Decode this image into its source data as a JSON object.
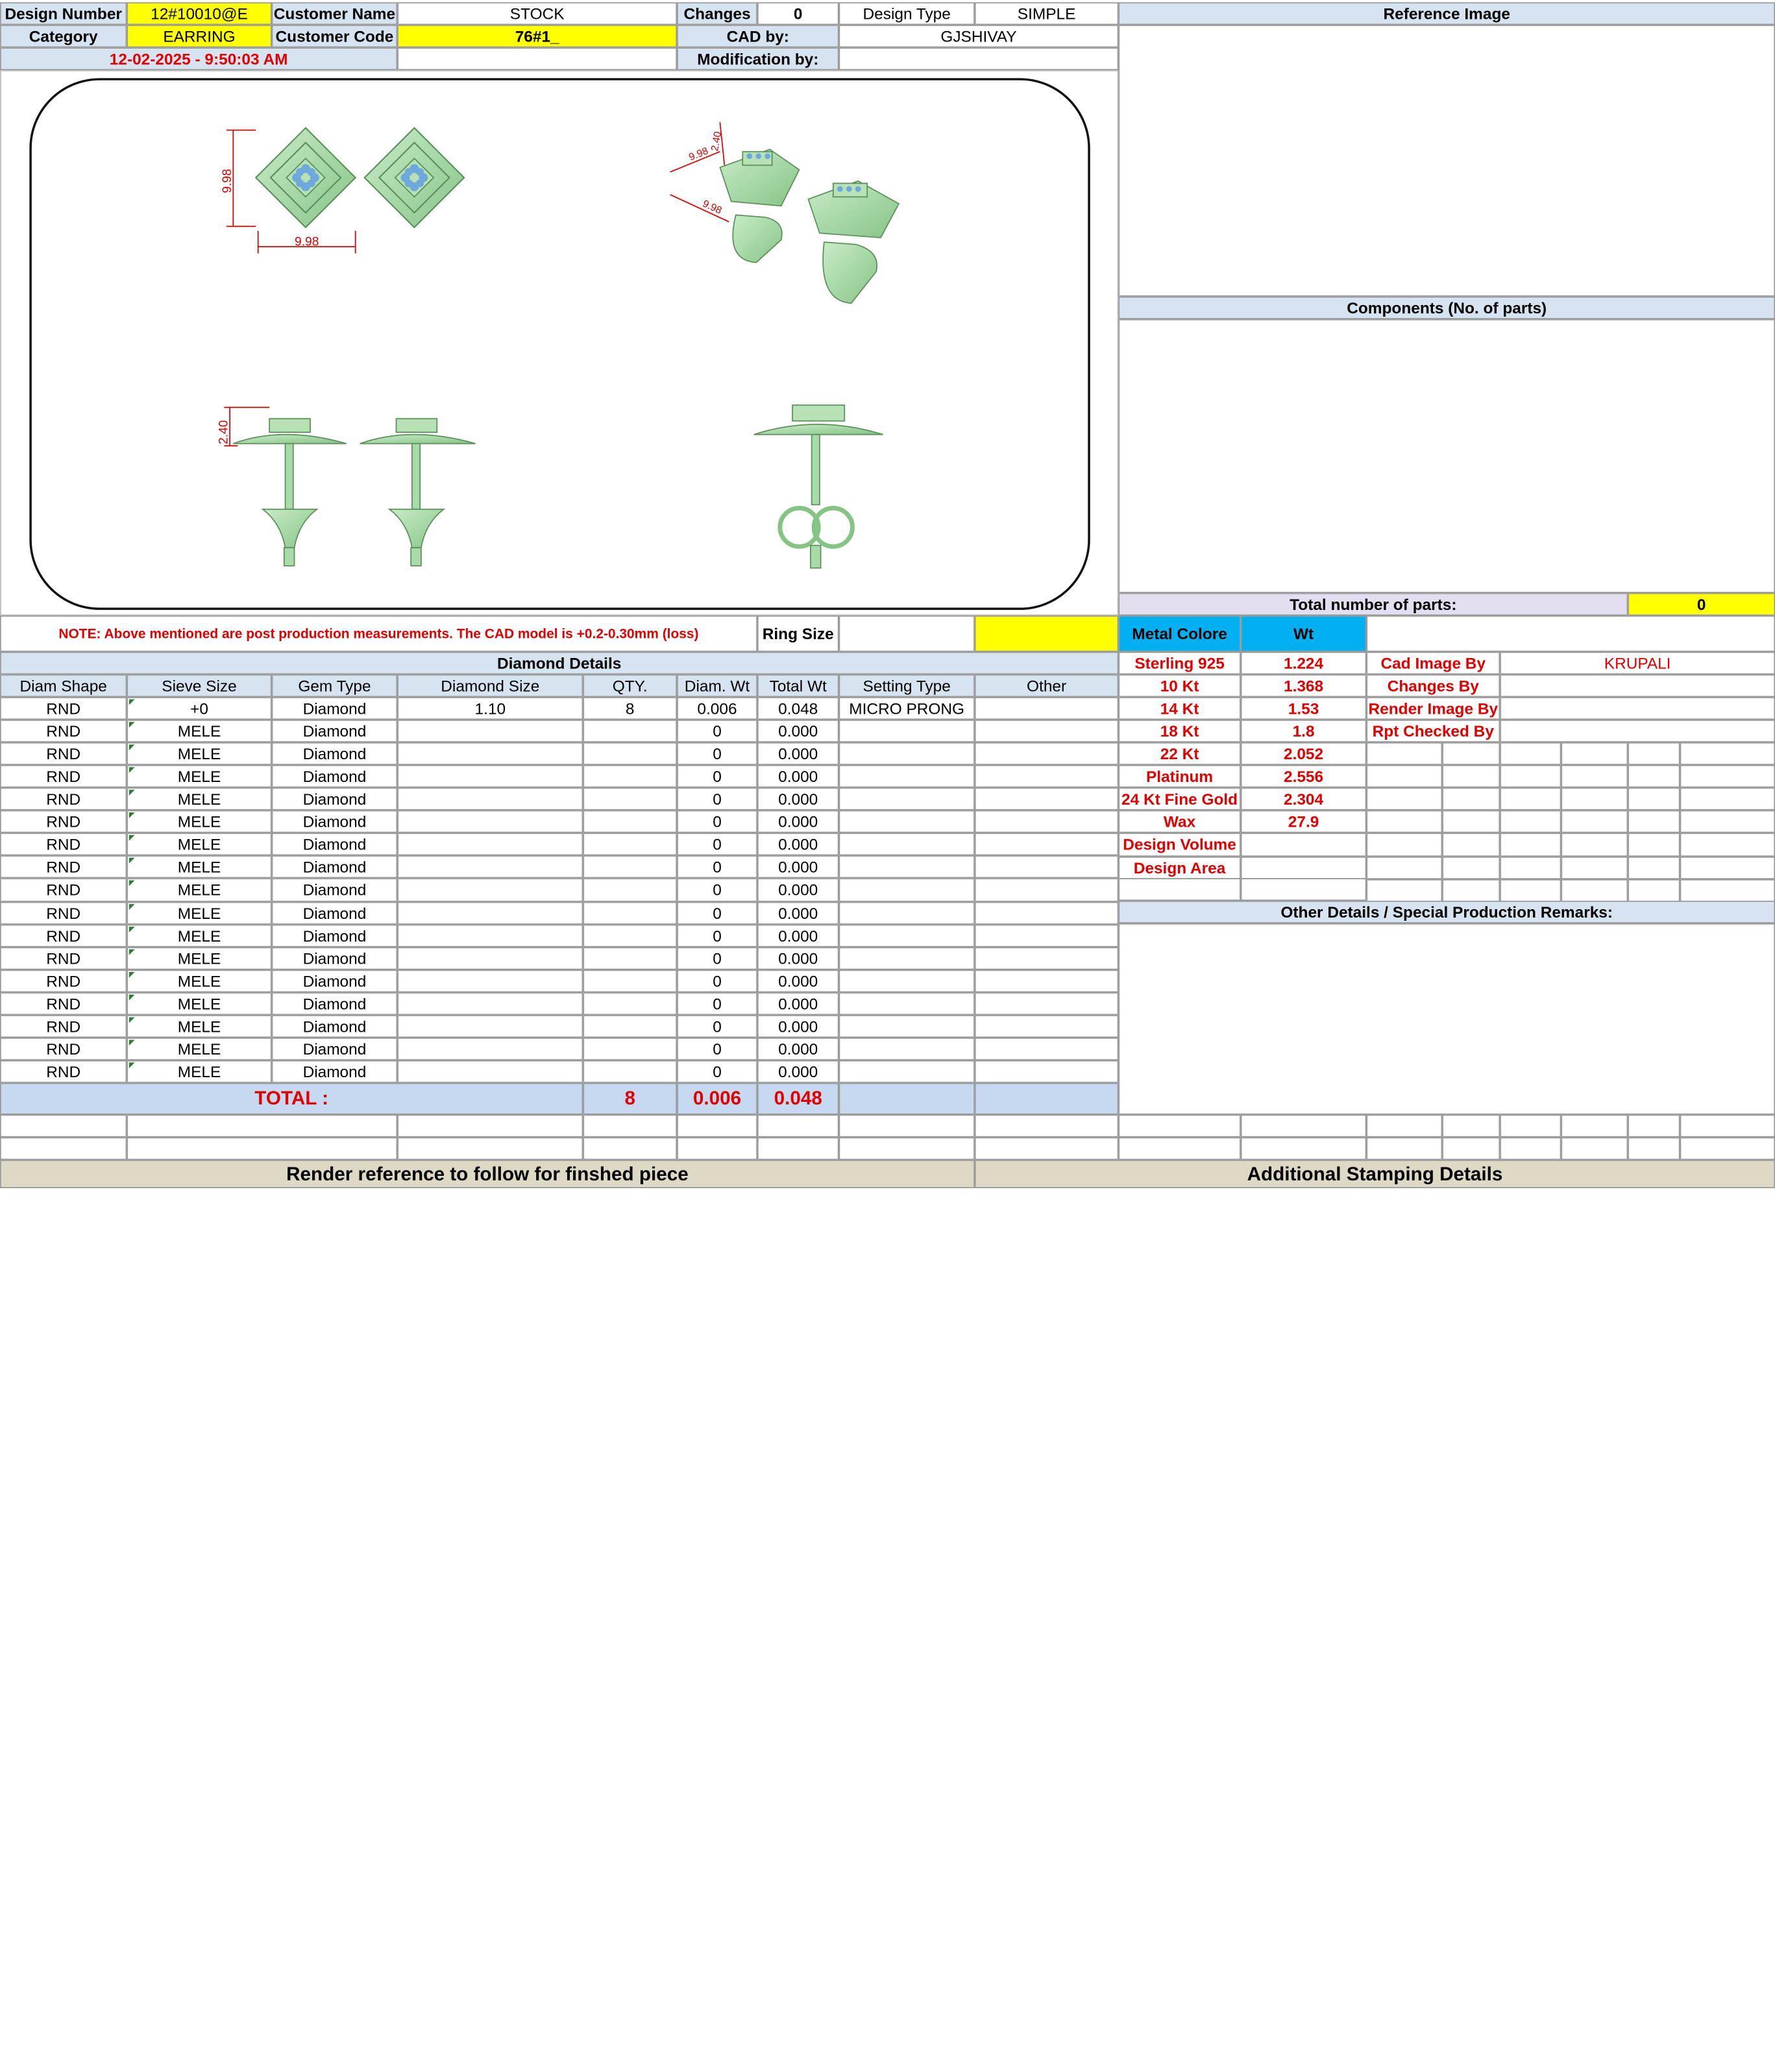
{
  "header": {
    "design_number_label": "Design Number",
    "design_number": "12#10010@E",
    "customer_name_label": "Customer Name",
    "customer_name": "STOCK",
    "changes_label": "Changes",
    "changes": "0",
    "design_type_label": "Design Type",
    "design_type": "SIMPLE",
    "category_label": "Category",
    "category": "EARRING",
    "customer_code_label": "Customer Code",
    "customer_code": "76#1_",
    "cad_by_label": "CAD by:",
    "cad_by": "GJSHIVAY",
    "modification_by_label": "Modification by:",
    "date": "12-02-2025 - 9:50:03 AM"
  },
  "reference_image_label": "Reference Image",
  "components_label": "Components (No. of parts)",
  "total_parts_label": "Total number of parts:",
  "total_parts": "0",
  "drawing": {
    "dim_width": "9.98",
    "dim_height": "9.98",
    "dim_depth": "2.40"
  },
  "note": "NOTE: Above mentioned are post production measurements. The CAD model is +0.2-0.30mm (loss)",
  "ring_size_label": "Ring Size",
  "metal": {
    "colore_label": "Metal Colore",
    "wt_label": "Wt",
    "rows": [
      {
        "name": "Sterling 925",
        "wt": "1.224"
      },
      {
        "name": "10 Kt",
        "wt": "1.368"
      },
      {
        "name": "14 Kt",
        "wt": "1.53"
      },
      {
        "name": "18 Kt",
        "wt": "1.8"
      },
      {
        "name": "22 Kt",
        "wt": "2.052"
      },
      {
        "name": "Platinum",
        "wt": "2.556"
      },
      {
        "name": "24 Kt Fine Gold",
        "wt": "2.304"
      },
      {
        "name": "Wax",
        "wt": "27.9"
      },
      {
        "name": "Design Volume",
        "wt": ""
      },
      {
        "name": "Design Area",
        "wt": ""
      }
    ]
  },
  "credits": [
    {
      "label": "Cad Image By",
      "value": "KRUPALI"
    },
    {
      "label": "Changes By",
      "value": ""
    },
    {
      "label": "Render Image By",
      "value": ""
    },
    {
      "label": "Rpt Checked By",
      "value": ""
    }
  ],
  "other_details_label": "Other Details / Special Production Remarks:",
  "diamond": {
    "title": "Diamond Details",
    "headers": [
      "Diam Shape",
      "Sieve Size",
      "Gem Type",
      "Diamond Size",
      "QTY.",
      "Diam. Wt",
      "Total Wt",
      "Setting Type",
      "Other"
    ],
    "rows": [
      [
        "RND",
        "+0",
        "Diamond",
        "1.10",
        "8",
        "0.006",
        "0.048",
        "MICRO PRONG",
        ""
      ],
      [
        "RND",
        "MELE",
        "Diamond",
        "",
        "",
        "0",
        "0.000",
        "",
        ""
      ],
      [
        "RND",
        "MELE",
        "Diamond",
        "",
        "",
        "0",
        "0.000",
        "",
        ""
      ],
      [
        "RND",
        "MELE",
        "Diamond",
        "",
        "",
        "0",
        "0.000",
        "",
        ""
      ],
      [
        "RND",
        "MELE",
        "Diamond",
        "",
        "",
        "0",
        "0.000",
        "",
        ""
      ],
      [
        "RND",
        "MELE",
        "Diamond",
        "",
        "",
        "0",
        "0.000",
        "",
        ""
      ],
      [
        "RND",
        "MELE",
        "Diamond",
        "",
        "",
        "0",
        "0.000",
        "",
        ""
      ],
      [
        "RND",
        "MELE",
        "Diamond",
        "",
        "",
        "0",
        "0.000",
        "",
        ""
      ],
      [
        "RND",
        "MELE",
        "Diamond",
        "",
        "",
        "0",
        "0.000",
        "",
        ""
      ],
      [
        "RND",
        "MELE",
        "Diamond",
        "",
        "",
        "0",
        "0.000",
        "",
        ""
      ],
      [
        "RND",
        "MELE",
        "Diamond",
        "",
        "",
        "0",
        "0.000",
        "",
        ""
      ],
      [
        "RND",
        "MELE",
        "Diamond",
        "",
        "",
        "0",
        "0.000",
        "",
        ""
      ],
      [
        "RND",
        "MELE",
        "Diamond",
        "",
        "",
        "0",
        "0.000",
        "",
        ""
      ],
      [
        "RND",
        "MELE",
        "Diamond",
        "",
        "",
        "0",
        "0.000",
        "",
        ""
      ],
      [
        "RND",
        "MELE",
        "Diamond",
        "",
        "",
        "0",
        "0.000",
        "",
        ""
      ],
      [
        "RND",
        "MELE",
        "Diamond",
        "",
        "",
        "0",
        "0.000",
        "",
        ""
      ],
      [
        "RND",
        "MELE",
        "Diamond",
        "",
        "",
        "0",
        "0.000",
        "",
        ""
      ]
    ],
    "total_label": "TOTAL :",
    "total_qty": "8",
    "total_diam_wt": "0.006",
    "total_wt": "0.048"
  },
  "footer": {
    "render_reference": "Render reference to follow for finshed piece",
    "additional_stamping": "Additional Stamping Details"
  },
  "colors": {
    "header_blue": "#d6e3f0",
    "highlight_yellow": "#ffff00",
    "metal_cyan": "#00b0f0",
    "value_red": "#e00000",
    "model_green": "#a8dba8"
  }
}
